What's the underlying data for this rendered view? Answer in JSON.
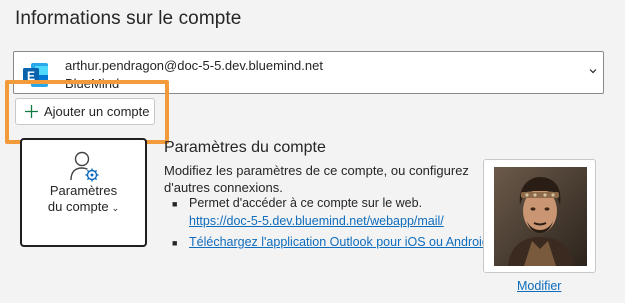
{
  "page": {
    "title": "Informations sur le compte"
  },
  "account": {
    "email": "arthur.pendragon@doc-5-5.dev.bluemind.net",
    "type": "BlueMind",
    "icon": "exchange-icon"
  },
  "add_account": {
    "label": "Ajouter un compte",
    "icon": "plus-icon"
  },
  "settings_tile": {
    "label_line1": "Paramètres",
    "label_line2": "du compte",
    "chevron": "⌄",
    "icon": "user-gear-icon"
  },
  "settings_section": {
    "title": "Paramètres du compte",
    "description": "Modifiez les paramètres de ce compte, ou configurez d'autres connexions.",
    "bullet1_text": "Permet d'accéder à ce compte sur le web.",
    "bullet1_link": "https://doc-5-5.dev.bluemind.net/webapp/mail/",
    "bullet2_link": "Téléchargez l'application Outlook pour iOS ou Android."
  },
  "profile": {
    "modify_label": "Modifier"
  },
  "colors": {
    "highlight": "#f39a3a",
    "link": "#0f6cbd",
    "exchange_blue": "#0f6cbd",
    "background": "#f3f3f3"
  }
}
